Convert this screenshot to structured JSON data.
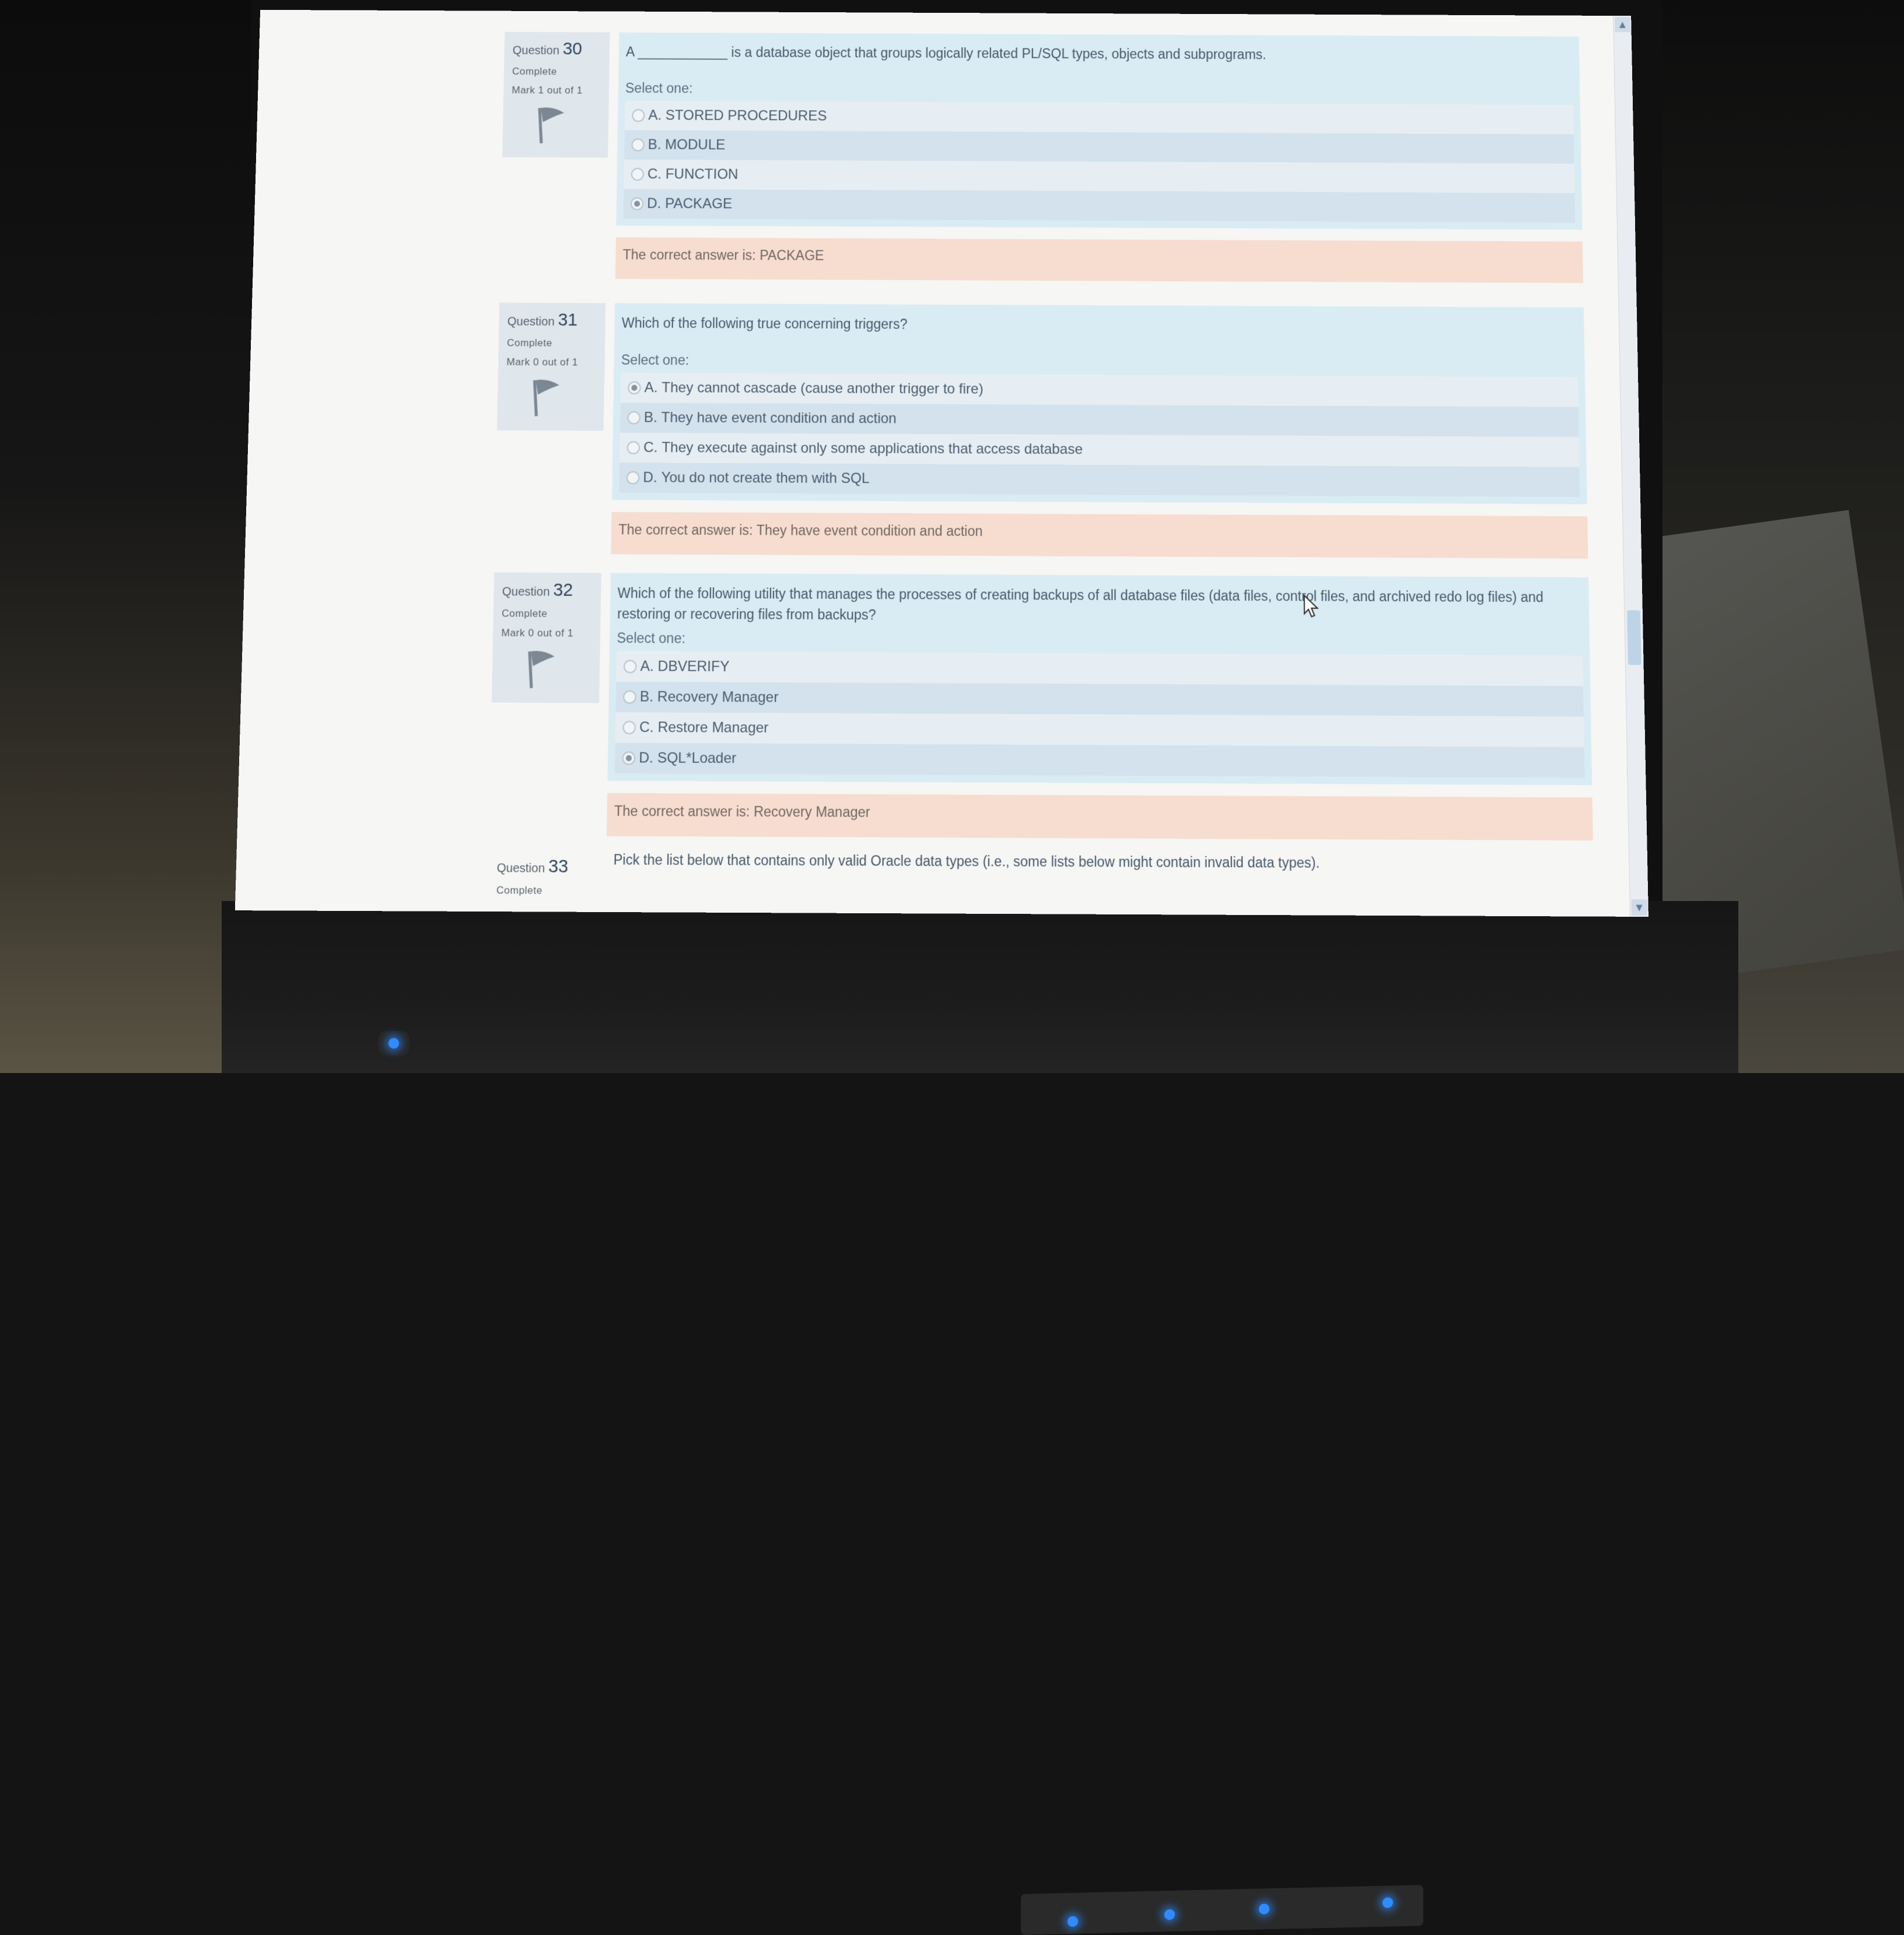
{
  "questions": [
    {
      "number_label": "Question",
      "number": "30",
      "state": "Complete",
      "grade": "Mark 1 out of 1",
      "text": "A ____________ is a database object that groups logically related PL/SQL types, objects and subprograms.",
      "prompt": "Select one:",
      "options": [
        {
          "letter": "A.",
          "text": "STORED PROCEDURES",
          "selected": false
        },
        {
          "letter": "B.",
          "text": "MODULE",
          "selected": false
        },
        {
          "letter": "C.",
          "text": "FUNCTION",
          "selected": false
        },
        {
          "letter": "D.",
          "text": "PACKAGE",
          "selected": true
        }
      ],
      "feedback": "The correct answer is: PACKAGE"
    },
    {
      "number_label": "Question",
      "number": "31",
      "state": "Complete",
      "grade": "Mark 0 out of 1",
      "text": "Which of the following true concerning triggers?",
      "prompt": "Select one:",
      "options": [
        {
          "letter": "A.",
          "text": "They cannot cascade (cause another trigger to fire)",
          "selected": true
        },
        {
          "letter": "B.",
          "text": "They have event condition and action",
          "selected": false
        },
        {
          "letter": "C.",
          "text": "They execute against only some applications that access database",
          "selected": false
        },
        {
          "letter": "D.",
          "text": "You do not create them with SQL",
          "selected": false
        }
      ],
      "feedback": "The correct answer is: They have event condition and action"
    },
    {
      "number_label": "Question",
      "number": "32",
      "state": "Complete",
      "grade": "Mark 0 out of 1",
      "text": "Which of the following utility that manages the processes of creating backups of all database files (data files, control files, and archived redo log files) and restoring or recovering files from backups?",
      "prompt": "Select one:",
      "options": [
        {
          "letter": "A.",
          "text": "DBVERIFY",
          "selected": false
        },
        {
          "letter": "B.",
          "text": "Recovery Manager",
          "selected": false
        },
        {
          "letter": "C.",
          "text": "Restore Manager",
          "selected": false
        },
        {
          "letter": "D.",
          "text": "SQL*Loader",
          "selected": true
        }
      ],
      "feedback": "The correct answer is: Recovery Manager"
    },
    {
      "number_label": "Question",
      "number": "33",
      "state": "Complete",
      "text": "Pick the list below that contains only valid Oracle data types (i.e., some lists below might contain invalid data types)."
    }
  ],
  "icons": {
    "flag": "flag-icon",
    "scroll_up": "chevron-up-icon",
    "scroll_down": "chevron-down-icon",
    "cursor": "mouse-cursor-icon"
  },
  "colors": {
    "question_bg": "#d9ecf3",
    "info_bg": "#dfe6ec",
    "feedback_bg": "#f6ddd0",
    "led_blue": "#2e8cff"
  }
}
